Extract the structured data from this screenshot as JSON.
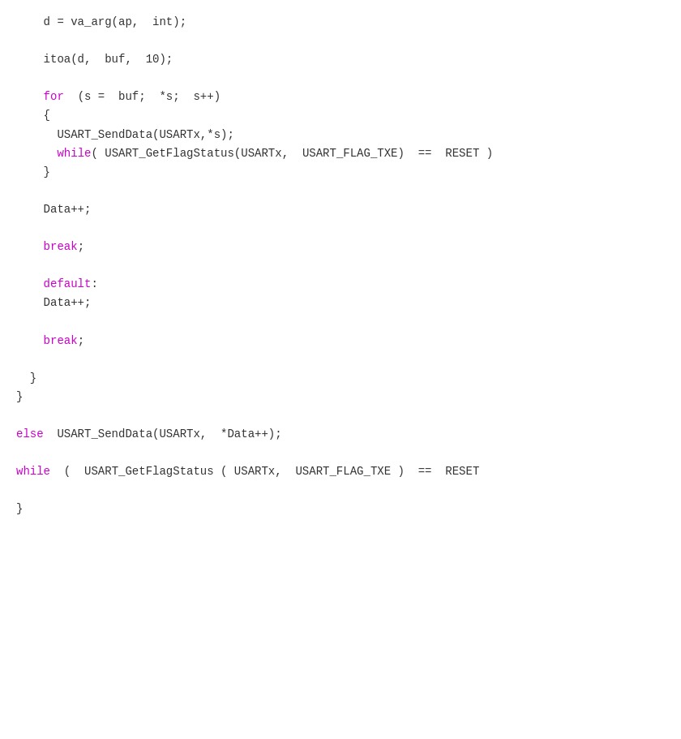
{
  "code": {
    "lines": [
      {
        "id": "line1",
        "type": "normal",
        "indent": "    ",
        "content": "d = va_arg(ap,  int);"
      },
      {
        "id": "line2",
        "type": "empty"
      },
      {
        "id": "line3",
        "type": "normal",
        "indent": "    ",
        "content": "itoa(d,  buf,  10);"
      },
      {
        "id": "line4",
        "type": "empty"
      },
      {
        "id": "line5",
        "type": "mixed",
        "indent": "    ",
        "parts": [
          {
            "text": "for",
            "style": "keyword"
          },
          {
            "text": "  (s =  buf;  *s;  s++)",
            "style": "normal"
          }
        ]
      },
      {
        "id": "line6",
        "type": "normal",
        "indent": "    ",
        "content": "{"
      },
      {
        "id": "line7",
        "type": "normal",
        "indent": "      ",
        "content": "USART_SendData(USARTx,*s);"
      },
      {
        "id": "line8",
        "type": "mixed",
        "indent": "      ",
        "parts": [
          {
            "text": "while",
            "style": "keyword"
          },
          {
            "text": "( USART_GetFlagStatus(USARTx,  USART_FLAG_TXE)  ==  RESET )",
            "style": "normal"
          }
        ]
      },
      {
        "id": "line9",
        "type": "normal",
        "indent": "    ",
        "content": "}"
      },
      {
        "id": "line10",
        "type": "empty"
      },
      {
        "id": "line11",
        "type": "normal",
        "indent": "    ",
        "content": "Data++;"
      },
      {
        "id": "line12",
        "type": "empty"
      },
      {
        "id": "line13",
        "type": "mixed",
        "indent": "    ",
        "parts": [
          {
            "text": "break",
            "style": "keyword"
          },
          {
            "text": ";",
            "style": "normal"
          }
        ]
      },
      {
        "id": "line14",
        "type": "empty"
      },
      {
        "id": "line15",
        "type": "mixed",
        "indent": "    ",
        "parts": [
          {
            "text": "default",
            "style": "keyword"
          },
          {
            "text": ":",
            "style": "normal"
          }
        ]
      },
      {
        "id": "line16",
        "type": "normal",
        "indent": "    ",
        "content": "Data++;"
      },
      {
        "id": "line17",
        "type": "empty"
      },
      {
        "id": "line18",
        "type": "mixed",
        "indent": "    ",
        "parts": [
          {
            "text": "break",
            "style": "keyword"
          },
          {
            "text": ";",
            "style": "normal"
          }
        ]
      },
      {
        "id": "line19",
        "type": "empty"
      },
      {
        "id": "line20",
        "type": "normal",
        "indent": "  ",
        "content": "}"
      },
      {
        "id": "line21",
        "type": "normal",
        "indent": "",
        "content": "}"
      },
      {
        "id": "line22",
        "type": "empty"
      },
      {
        "id": "line23",
        "type": "mixed",
        "indent": "",
        "parts": [
          {
            "text": "else",
            "style": "keyword"
          },
          {
            "text": "  USART_SendData(USARTx,  *Data++);",
            "style": "normal"
          }
        ]
      },
      {
        "id": "line24",
        "type": "empty"
      },
      {
        "id": "line25",
        "type": "mixed",
        "indent": "",
        "parts": [
          {
            "text": "while",
            "style": "keyword"
          },
          {
            "text": "  (  USART_GetFlagStatus ( USARTx,  USART_FLAG_TXE )  ==  RESET",
            "style": "normal"
          }
        ]
      },
      {
        "id": "line26",
        "type": "empty"
      },
      {
        "id": "line27",
        "type": "normal",
        "indent": "",
        "content": "}"
      }
    ]
  }
}
